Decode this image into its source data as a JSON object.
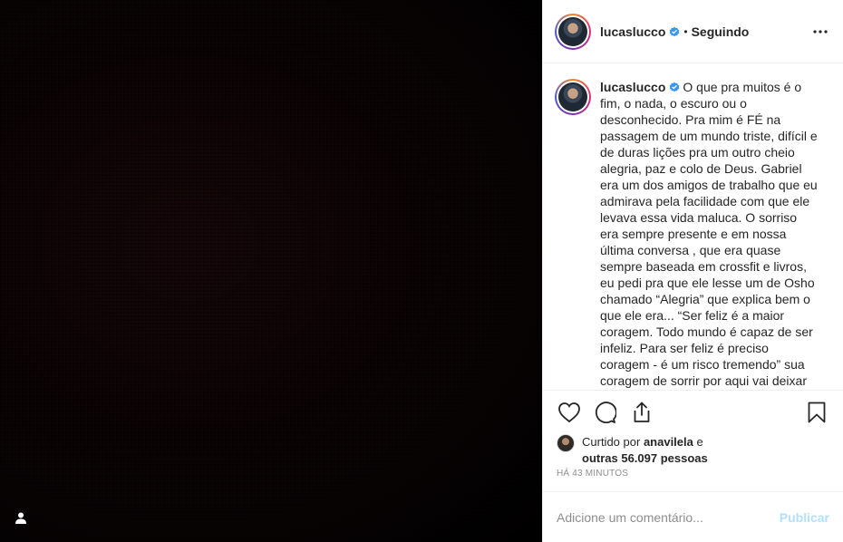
{
  "post": {
    "username": "lucaslucco",
    "follow_separator": "•",
    "follow_status": "Seguindo",
    "caption": "O que pra muitos é o fim, o nada, o escuro ou o desconhecido. Pra mim é FÉ na passagem de um mundo triste, difícil e de duras lições pra um outro cheio alegria, paz e colo de Deus. Gabriel era um dos amigos de trabalho que eu admirava pela facilidade com que ele levava essa vida maluca. O sorriso era sempre presente e em nossa última conversa , que era quase sempre baseada em crossfit e livros, eu pedi pra que ele lesse um de Osho chamado “Alegria” que explica bem o que ele era... “Ser feliz é a maior coragem. Todo mundo é capaz de ser infeliz. Para ser feliz é preciso coragem - é um risco tremendo” sua coragem de sorrir por aqui vai deixar saudade",
    "likes_prefix": "Curtido por",
    "liked_by_user": "anavilela",
    "likes_connector": " e",
    "likes_others": "outras 56.097 pessoas",
    "timestamp": "HÁ 43 MINUTOS"
  },
  "comment": {
    "placeholder": "Adicione um comentário...",
    "publish_label": "Publicar"
  },
  "icons": {
    "more": "more-horizontal-icon",
    "like": "heart-icon",
    "comment": "comment-bubble-icon",
    "share": "share-icon",
    "save": "bookmark-icon",
    "tag": "user-tag-icon",
    "verified": "verified-badge-icon"
  },
  "colors": {
    "verified": "#3897f0",
    "publish_disabled": "#b2dffc",
    "muted_text": "#8e8e8e"
  }
}
